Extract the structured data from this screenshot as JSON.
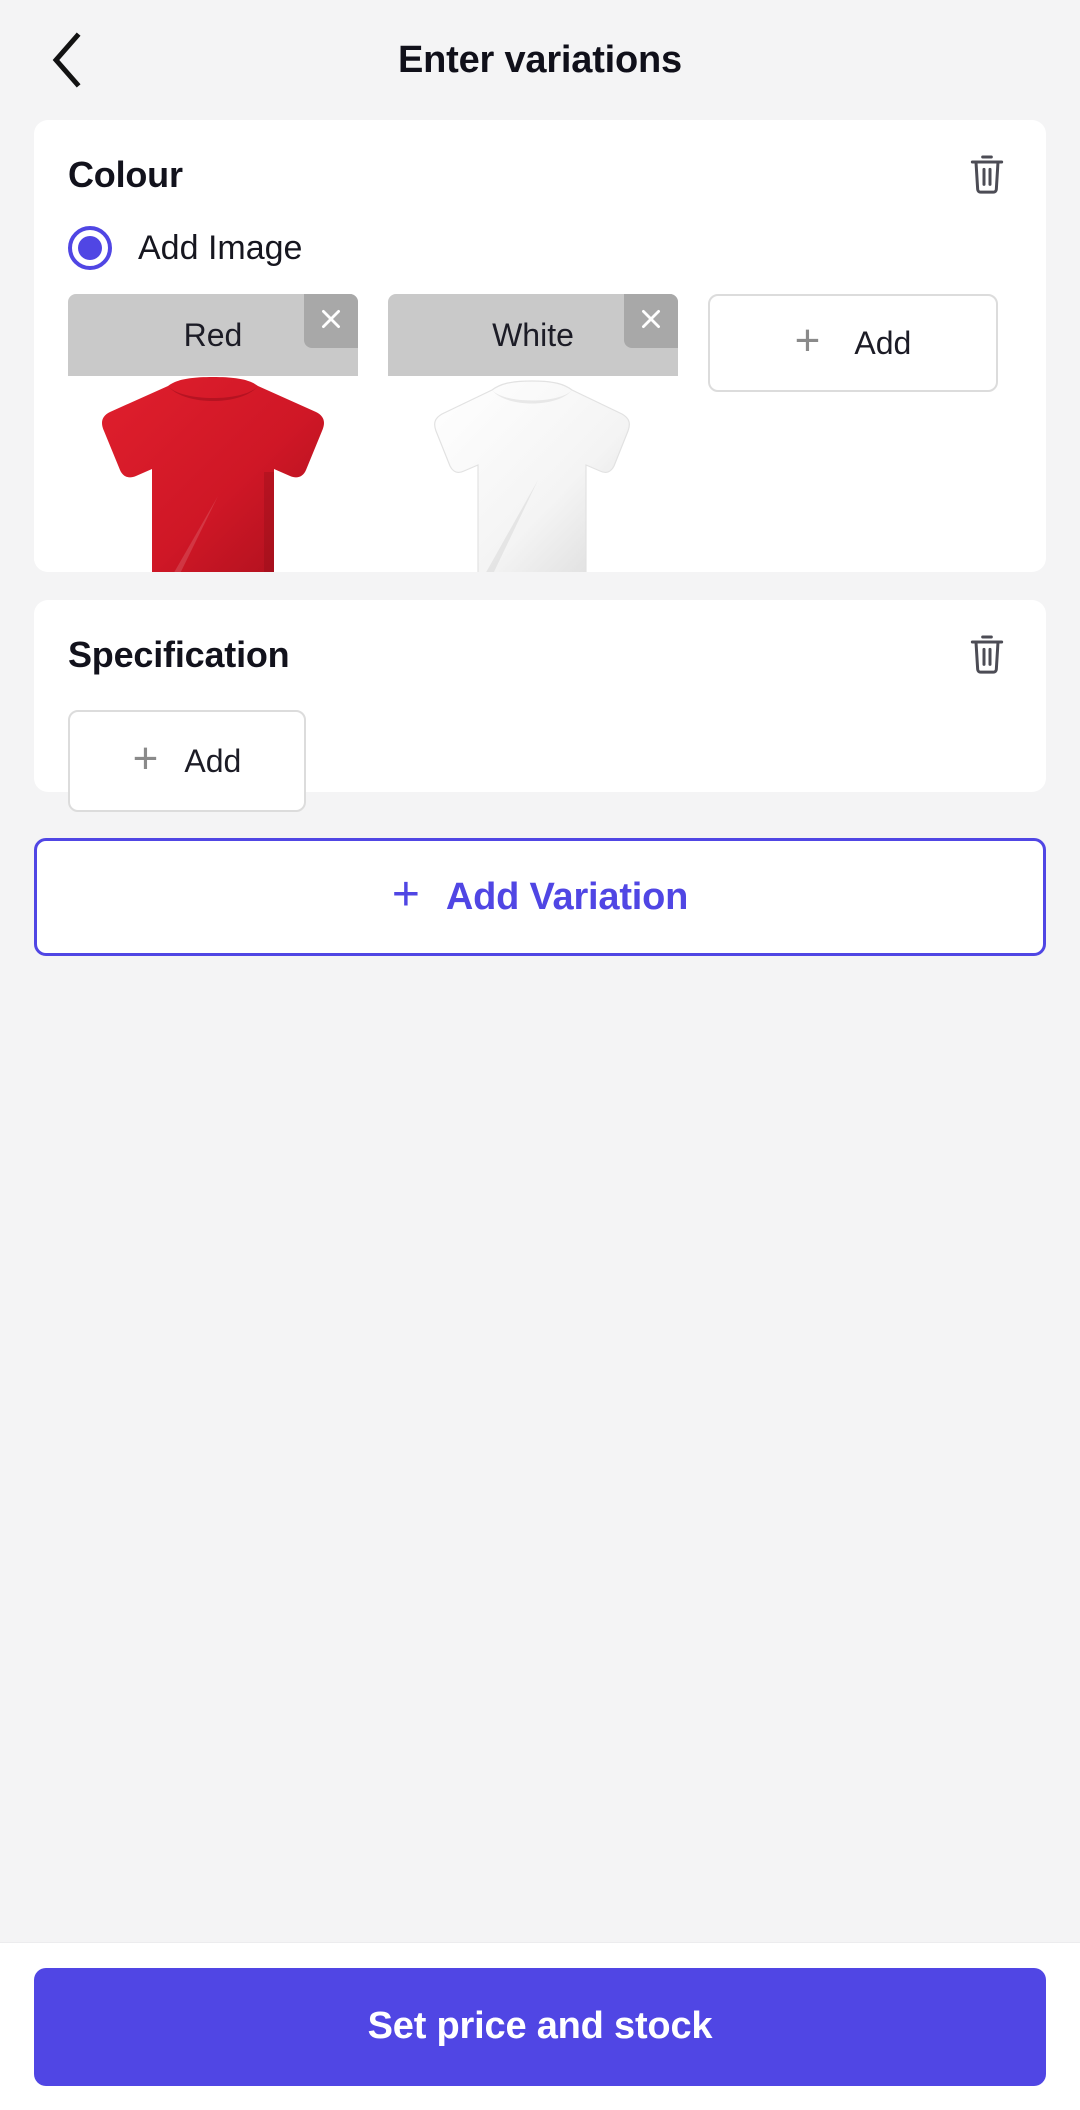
{
  "header": {
    "title": "Enter variations",
    "back_icon": "chevron-left-icon"
  },
  "colour_section": {
    "title": "Colour",
    "delete_icon": "trash-icon",
    "option": {
      "label": "Add Image",
      "selected": true,
      "icon": "radio-selected-icon"
    },
    "variants": [
      {
        "label": "Red",
        "close_icon": "close-icon",
        "swatch": "#cf1726"
      },
      {
        "label": "White",
        "close_icon": "close-icon",
        "swatch": "#f2f2f2"
      }
    ],
    "add_button": {
      "label": "Add",
      "icon": "plus-icon"
    }
  },
  "specification_section": {
    "title": "Specification",
    "delete_icon": "trash-icon",
    "add_button": {
      "label": "Add",
      "icon": "plus-icon"
    }
  },
  "add_variation_button": {
    "label": "Add Variation",
    "icon": "plus-icon"
  },
  "bottom_bar": {
    "cta_label": "Set price and stock"
  },
  "colors": {
    "accent": "#5046e4",
    "page_background": "#f4f4f5",
    "card_background": "#ffffff",
    "chip_background": "#c9c9c9",
    "chip_close_background": "#a8a8a8",
    "title_text": "#12121c",
    "muted_icon": "#8a8a8a"
  }
}
